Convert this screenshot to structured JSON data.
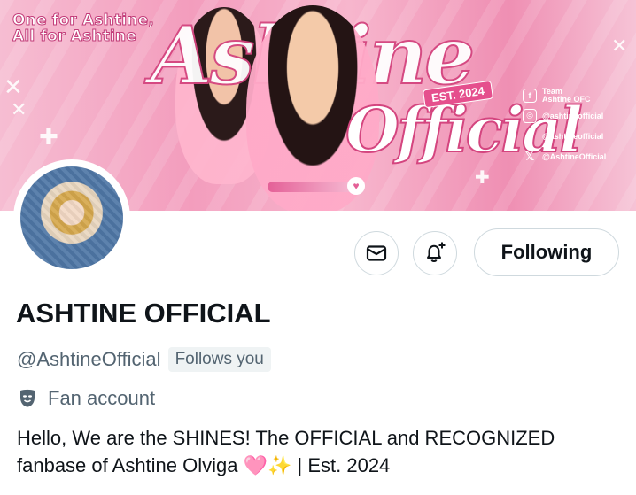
{
  "banner": {
    "tagline_line1": "One for Ashtine,",
    "tagline_line2": "All for Ashtine",
    "title_script": "Ashtine",
    "title_sub": "Official",
    "est_badge": "EST. 2024",
    "socials": [
      {
        "icon": "facebook-icon",
        "glyph": "f",
        "label_line1": "Team",
        "label_line2": "Ashtine OFC"
      },
      {
        "icon": "instagram-icon",
        "glyph": "◎",
        "label": "@ashtineofficial"
      },
      {
        "icon": "tiktok-icon",
        "glyph": "♪",
        "label": "@ashtineofficial"
      },
      {
        "icon": "x-icon",
        "glyph": "𝕏",
        "label": "@AshtineOfficial"
      }
    ],
    "colors": {
      "pink": "#f39dbd",
      "hot_pink": "#e54f8d"
    }
  },
  "actions": {
    "message_icon": "envelope-icon",
    "notify_icon": "bell-plus-icon",
    "following_label": "Following"
  },
  "profile": {
    "display_name": "ASHTINE OFFICIAL",
    "handle": "@AshtineOfficial",
    "follows_you": "Follows you",
    "category_icon": "theater-mask-icon",
    "category": "Fan account",
    "bio": "Hello, We are the SHINES! The OFFICIAL and RECOGNIZED fanbase of Ashtine Olviga 🩷✨ | Est. 2024"
  }
}
